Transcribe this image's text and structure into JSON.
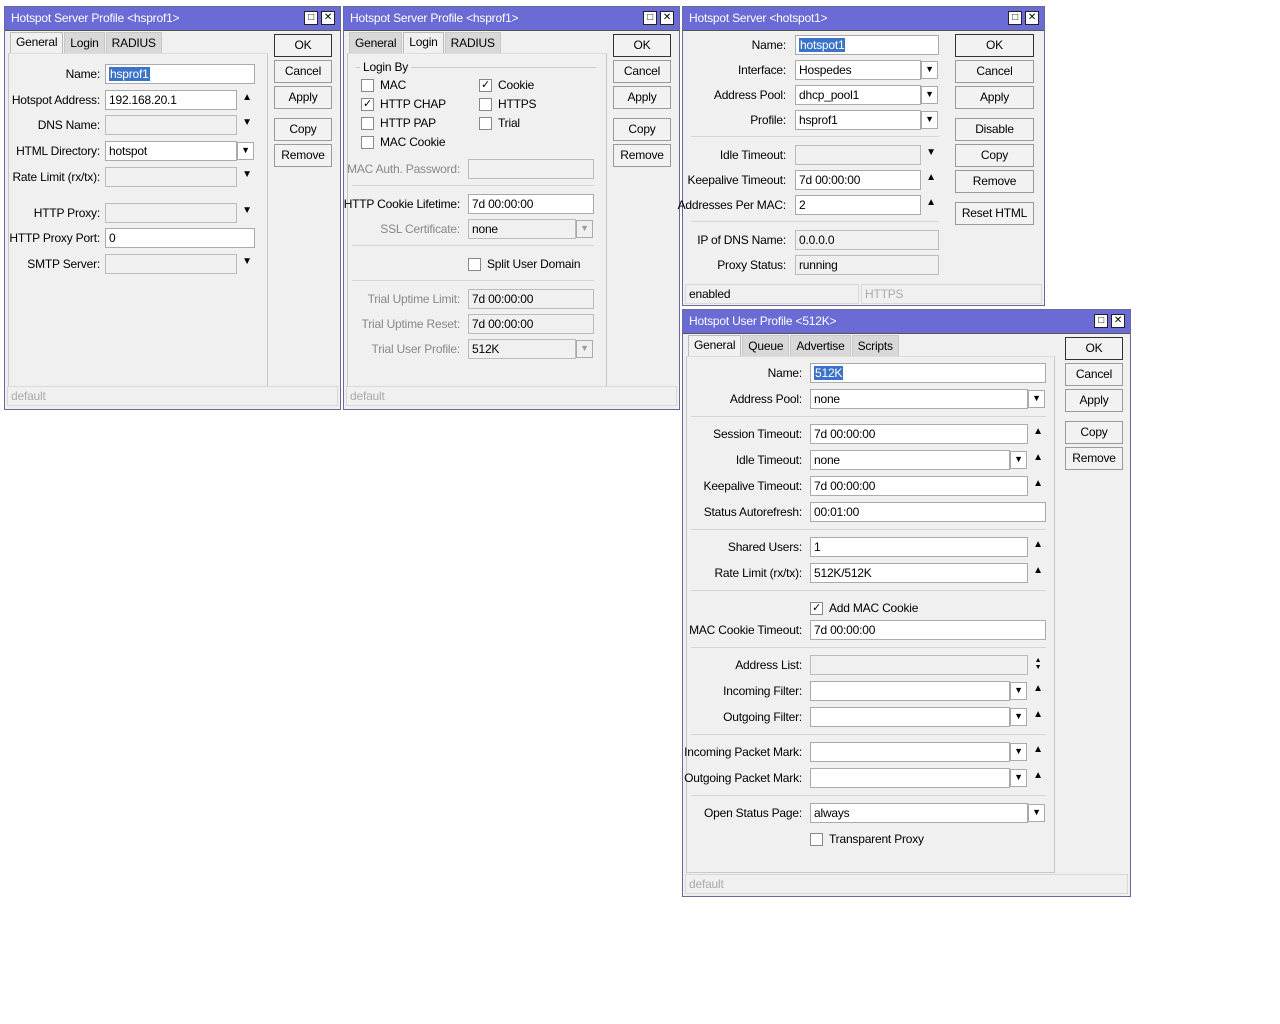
{
  "windows": [
    {
      "id": "w1",
      "title": "Hotspot Server Profile <hsprof1>",
      "tabs": [
        "General",
        "Login",
        "RADIUS"
      ],
      "active_tab": 0,
      "buttons": [
        "OK",
        "Cancel",
        "Apply",
        "Copy",
        "Remove"
      ],
      "status": [
        "default"
      ],
      "rows": [
        {
          "kind": "field",
          "label": "Name:",
          "value": "hsprof1",
          "type": "text",
          "selected": true
        },
        {
          "kind": "field",
          "label": "Hotspot Address:",
          "value": "192.168.20.1",
          "type": "up"
        },
        {
          "kind": "field",
          "label": "DNS Name:",
          "value": "",
          "type": "down",
          "gray": true
        },
        {
          "kind": "field",
          "label": "HTML Directory:",
          "value": "hotspot",
          "type": "dropdown"
        },
        {
          "kind": "field",
          "label": "Rate Limit (rx/tx):",
          "value": "",
          "type": "down",
          "gray": true
        },
        {
          "kind": "gap"
        },
        {
          "kind": "field",
          "label": "HTTP Proxy:",
          "value": "",
          "type": "down",
          "gray": true
        },
        {
          "kind": "field",
          "label": "HTTP Proxy Port:",
          "value": "0",
          "type": "text"
        },
        {
          "kind": "field",
          "label": "SMTP Server:",
          "value": "",
          "type": "down",
          "gray": true
        }
      ]
    },
    {
      "id": "w2",
      "title": "Hotspot Server Profile <hsprof1>",
      "tabs": [
        "General",
        "Login",
        "RADIUS"
      ],
      "active_tab": 1,
      "buttons": [
        "OK",
        "Cancel",
        "Apply",
        "Copy",
        "Remove"
      ],
      "status": [
        "default"
      ],
      "login_by": {
        "title": "Login By",
        "checks": [
          {
            "label": "MAC",
            "checked": false
          },
          {
            "label": "Cookie",
            "checked": true
          },
          {
            "label": "HTTP CHAP",
            "checked": true
          },
          {
            "label": "HTTPS",
            "checked": false
          },
          {
            "label": "HTTP PAP",
            "checked": false
          },
          {
            "label": "Trial",
            "checked": false
          },
          {
            "label": "MAC Cookie",
            "checked": false
          }
        ]
      },
      "rows": [
        {
          "kind": "field",
          "label": "MAC Auth. Password:",
          "value": "",
          "type": "text",
          "gray": true,
          "dis": true
        },
        {
          "kind": "sep"
        },
        {
          "kind": "field",
          "label": "HTTP Cookie Lifetime:",
          "value": "7d 00:00:00",
          "type": "text"
        },
        {
          "kind": "field",
          "label": "SSL Certificate:",
          "value": "none",
          "type": "dropdown",
          "gray": true,
          "dis": true
        },
        {
          "kind": "sep"
        },
        {
          "kind": "check",
          "label": "Split User Domain",
          "checked": false
        },
        {
          "kind": "sep"
        },
        {
          "kind": "field",
          "label": "Trial Uptime Limit:",
          "value": "7d 00:00:00",
          "type": "text",
          "gray": true,
          "dis": true
        },
        {
          "kind": "field",
          "label": "Trial Uptime Reset:",
          "value": "7d 00:00:00",
          "type": "text",
          "gray": true,
          "dis": true
        },
        {
          "kind": "field",
          "label": "Trial User Profile:",
          "value": "512K",
          "type": "dropdown",
          "gray": true,
          "dis": true
        }
      ]
    },
    {
      "id": "w3",
      "title": "Hotspot Server <hotspot1>",
      "tabs": [],
      "buttons": [
        "OK",
        "Cancel",
        "Apply",
        "Disable",
        "Copy",
        "Remove",
        "Reset HTML"
      ],
      "status": [
        "enabled",
        "HTTPS"
      ],
      "rows": [
        {
          "kind": "field",
          "label": "Name:",
          "value": "hotspot1",
          "type": "text",
          "selected": true
        },
        {
          "kind": "field",
          "label": "Interface:",
          "value": "Hospedes",
          "type": "dropdown"
        },
        {
          "kind": "field",
          "label": "Address Pool:",
          "value": "dhcp_pool1",
          "type": "dropdown"
        },
        {
          "kind": "field",
          "label": "Profile:",
          "value": "hsprof1",
          "type": "dropdown"
        },
        {
          "kind": "sep"
        },
        {
          "kind": "field",
          "label": "Idle Timeout:",
          "value": "",
          "type": "down",
          "gray": true
        },
        {
          "kind": "field",
          "label": "Keepalive Timeout:",
          "value": "7d 00:00:00",
          "type": "up"
        },
        {
          "kind": "field",
          "label": "Addresses Per MAC:",
          "value": "2",
          "type": "up"
        },
        {
          "kind": "sep"
        },
        {
          "kind": "field",
          "label": "IP of DNS Name:",
          "value": "0.0.0.0",
          "type": "text",
          "gray": true
        },
        {
          "kind": "field",
          "label": "Proxy Status:",
          "value": "running",
          "type": "text",
          "gray": true
        }
      ]
    },
    {
      "id": "w4",
      "title": "Hotspot User Profile <512K>",
      "tabs": [
        "General",
        "Queue",
        "Advertise",
        "Scripts"
      ],
      "active_tab": 0,
      "buttons": [
        "OK",
        "Cancel",
        "Apply",
        "Copy",
        "Remove"
      ],
      "status": [
        "default"
      ],
      "rows": [
        {
          "kind": "field",
          "label": "Name:",
          "value": "512K",
          "type": "text",
          "selected": true
        },
        {
          "kind": "field",
          "label": "Address Pool:",
          "value": "none",
          "type": "dropdown"
        },
        {
          "kind": "sep"
        },
        {
          "kind": "field",
          "label": "Session Timeout:",
          "value": "7d 00:00:00",
          "type": "up"
        },
        {
          "kind": "field",
          "label": "Idle Timeout:",
          "value": "none",
          "type": "dropup"
        },
        {
          "kind": "field",
          "label": "Keepalive Timeout:",
          "value": "7d 00:00:00",
          "type": "up"
        },
        {
          "kind": "field",
          "label": "Status Autorefresh:",
          "value": "00:01:00",
          "type": "text"
        },
        {
          "kind": "sep"
        },
        {
          "kind": "field",
          "label": "Shared Users:",
          "value": "1",
          "type": "up"
        },
        {
          "kind": "field",
          "label": "Rate Limit (rx/tx):",
          "value": "512K/512K",
          "type": "up"
        },
        {
          "kind": "sep"
        },
        {
          "kind": "check",
          "label": "Add MAC Cookie",
          "checked": true,
          "short": true
        },
        {
          "kind": "field",
          "label": "MAC Cookie Timeout:",
          "value": "7d 00:00:00",
          "type": "text"
        },
        {
          "kind": "sep"
        },
        {
          "kind": "field",
          "label": "Address List:",
          "value": "",
          "type": "updown",
          "gray": true
        },
        {
          "kind": "field",
          "label": "Incoming Filter:",
          "value": "",
          "type": "dropup"
        },
        {
          "kind": "field",
          "label": "Outgoing Filter:",
          "value": "",
          "type": "dropup"
        },
        {
          "kind": "sep"
        },
        {
          "kind": "field",
          "label": "Incoming Packet Mark:",
          "value": "",
          "type": "dropup"
        },
        {
          "kind": "field",
          "label": "Outgoing Packet Mark:",
          "value": "",
          "type": "dropup"
        },
        {
          "kind": "sep"
        },
        {
          "kind": "field",
          "label": "Open Status Page:",
          "value": "always",
          "type": "dropdown"
        },
        {
          "kind": "check",
          "label": "Transparent Proxy",
          "checked": false,
          "short": true
        }
      ]
    }
  ]
}
